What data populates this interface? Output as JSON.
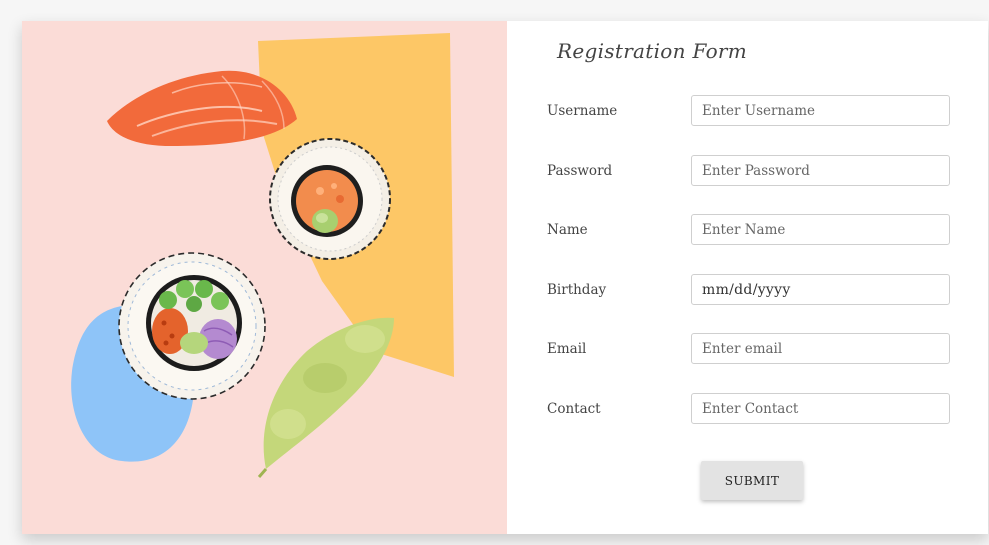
{
  "form": {
    "title": "Registration Form",
    "fields": [
      {
        "label": "Username",
        "placeholder": "Enter Username"
      },
      {
        "label": "Password",
        "placeholder": "Enter Password"
      },
      {
        "label": "Name",
        "placeholder": "Enter Name"
      },
      {
        "label": "Birthday",
        "value": "mm/dd/yyyy"
      },
      {
        "label": "Email",
        "placeholder": "Enter email"
      },
      {
        "label": "Contact",
        "placeholder": "Enter Contact"
      }
    ],
    "submit_label": "SUBMIT"
  },
  "colors": {
    "art_background": "#fbdcd7",
    "salmon": "#f26a3b",
    "yellow_shape": "#fdc766",
    "blue_shape": "#8ec4f8",
    "edamame": "#c4d77a"
  }
}
